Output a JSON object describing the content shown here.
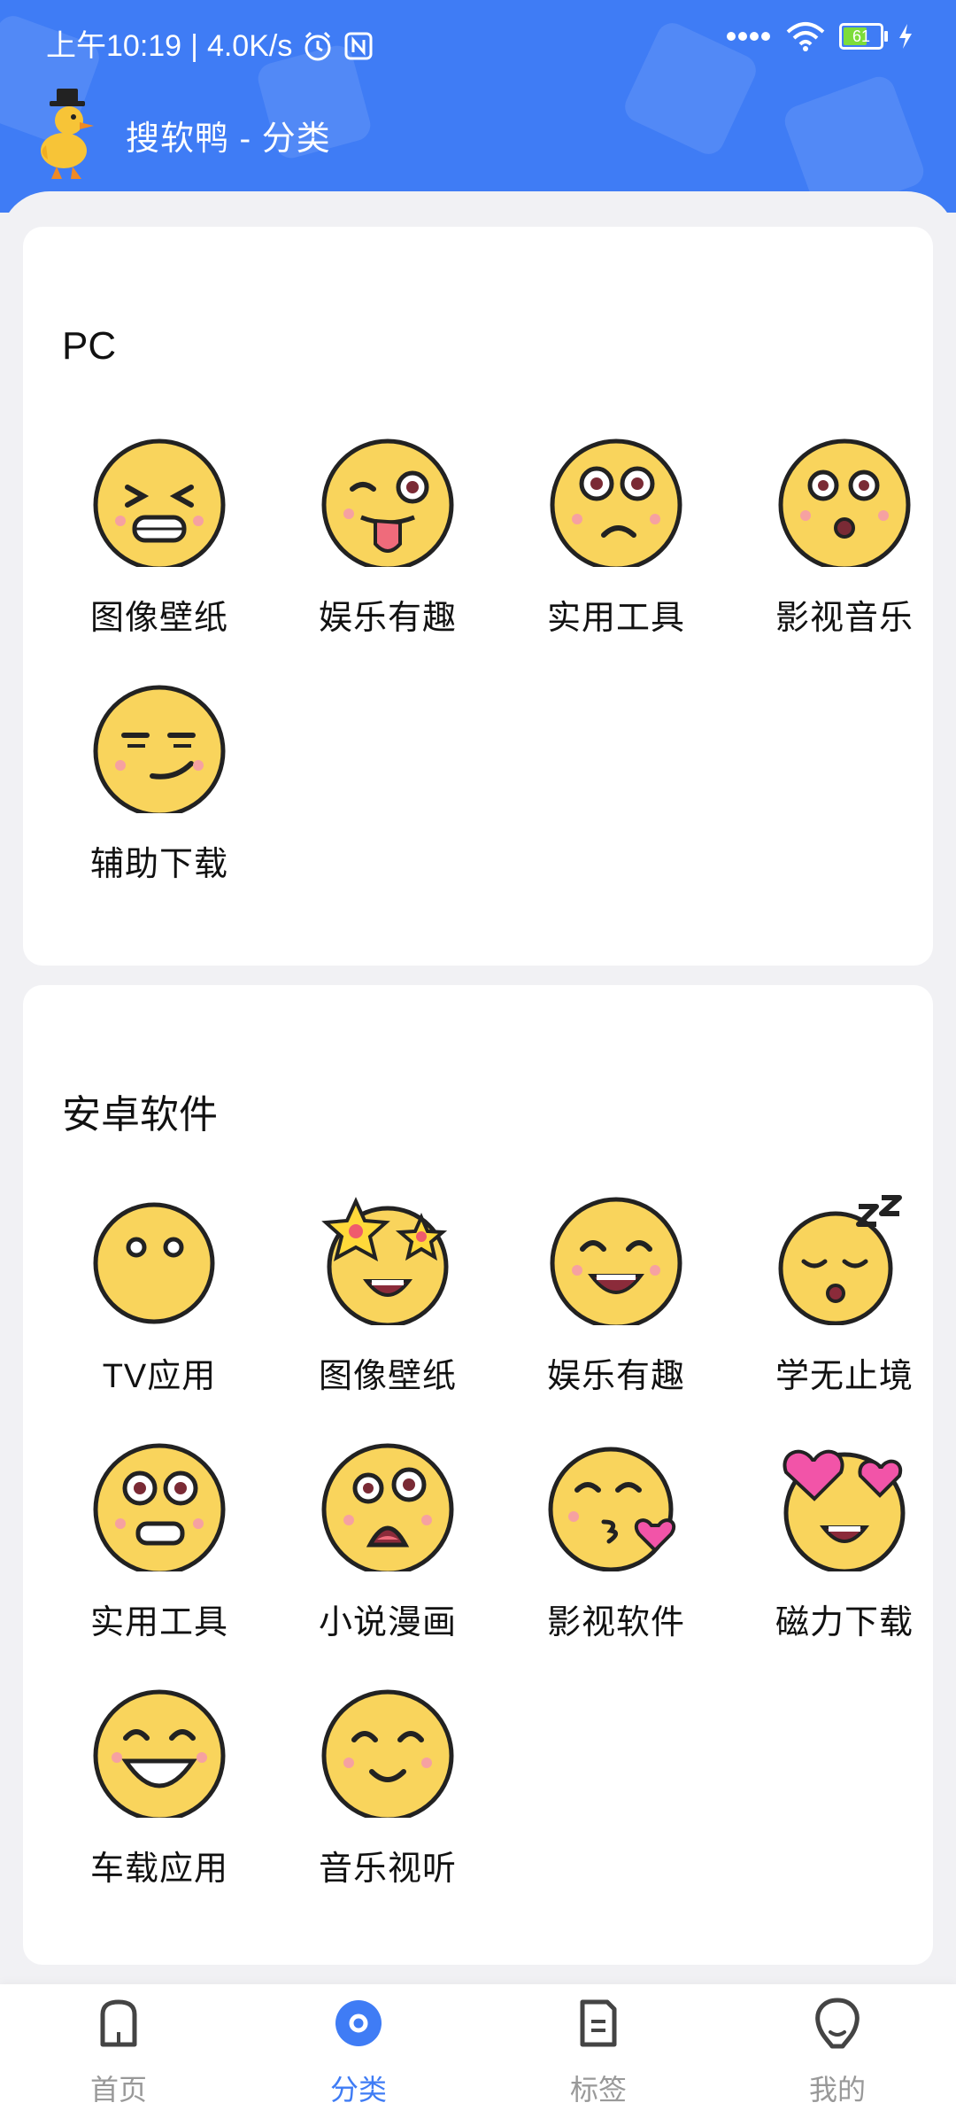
{
  "status_bar": {
    "time": "上午10:19",
    "speed": "4.0K/s",
    "battery": "61"
  },
  "app_bar": {
    "title": "搜软鸭 - 分类",
    "logo_icon": "duck-logo-icon"
  },
  "sections": [
    {
      "title": "PC",
      "items": [
        {
          "label": "图像壁纸",
          "icon": "squint-face-icon"
        },
        {
          "label": "娱乐有趣",
          "icon": "tongue-out-face-icon"
        },
        {
          "label": "实用工具",
          "icon": "confused-face-icon"
        },
        {
          "label": "影视音乐",
          "icon": "surprised-face-icon"
        },
        {
          "label": "辅助下载",
          "icon": "smirk-face-icon"
        }
      ]
    },
    {
      "title": "安卓软件",
      "items": [
        {
          "label": "TV应用",
          "icon": "neutral-face-icon"
        },
        {
          "label": "图像壁纸",
          "icon": "star-eyes-face-icon"
        },
        {
          "label": "娱乐有趣",
          "icon": "happy-face-icon"
        },
        {
          "label": "学无止境",
          "icon": "sleeping-face-icon"
        },
        {
          "label": "实用工具",
          "icon": "grimace-face-icon"
        },
        {
          "label": "小说漫画",
          "icon": "shocked-face-icon"
        },
        {
          "label": "影视软件",
          "icon": "kiss-face-icon"
        },
        {
          "label": "磁力下载",
          "icon": "heart-eyes-face-icon"
        },
        {
          "label": "车载应用",
          "icon": "grin-face-icon"
        },
        {
          "label": "音乐视听",
          "icon": "smile-face-icon"
        }
      ]
    }
  ],
  "tabbar": {
    "items": [
      {
        "label": "首页",
        "icon": "home-icon"
      },
      {
        "label": "分类",
        "icon": "category-icon"
      },
      {
        "label": "标签",
        "icon": "tag-icon"
      },
      {
        "label": "我的",
        "icon": "profile-icon"
      }
    ],
    "active_index": 1
  },
  "colors": {
    "header": "#3f7cf5",
    "face": "#f9d45c",
    "accent": "#3f7cf5"
  }
}
